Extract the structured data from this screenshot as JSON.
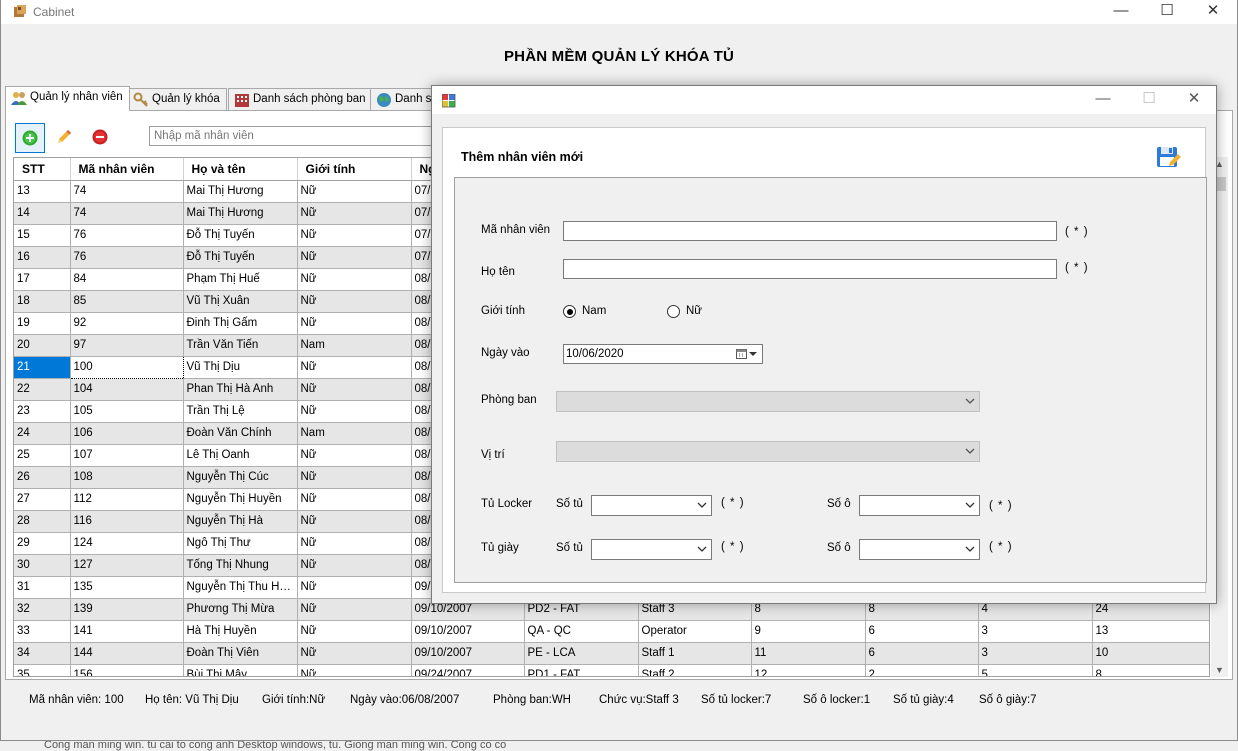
{
  "window": {
    "title": "Cabinet",
    "minimize": "—",
    "maximize": "☐",
    "close": "✕"
  },
  "app_heading": "PHẦN MỀM QUẢN LÝ KHÓA TỦ",
  "tabs": [
    {
      "label": "Quản lý nhân viên",
      "icon": "people-icon"
    },
    {
      "label": "Quản lý khóa",
      "icon": "key-icon"
    },
    {
      "label": "Danh sách phòng ban",
      "icon": "building-icon"
    },
    {
      "label": "Danh s",
      "icon": "globe-icon"
    }
  ],
  "toolbar": {
    "add_icon": "add-icon",
    "edit_icon": "pencil-icon",
    "delete_icon": "delete-icon",
    "search_placeholder": "Nhập mã nhân viên"
  },
  "grid": {
    "columns": [
      "STT",
      "Mã nhân viên",
      "Họ và tên",
      "Giới tính",
      "Ng",
      "",
      "",
      "",
      "",
      "",
      ""
    ],
    "rows": [
      [
        "13",
        "74",
        "Mai Thị Hương",
        "Nữ",
        "07/",
        "",
        "",
        "",
        "",
        "",
        ""
      ],
      [
        "14",
        "74",
        "Mai Thị Hương",
        "Nữ",
        "07/",
        "",
        "",
        "",
        "",
        "",
        ""
      ],
      [
        "15",
        "76",
        "Đỗ Thị Tuyến",
        "Nữ",
        "07/",
        "",
        "",
        "",
        "",
        "",
        ""
      ],
      [
        "16",
        "76",
        "Đỗ Thị Tuyến",
        "Nữ",
        "07/",
        "",
        "",
        "",
        "",
        "",
        ""
      ],
      [
        "17",
        "84",
        "Phạm Thị Huế",
        "Nữ",
        "08/",
        "",
        "",
        "",
        "",
        "",
        ""
      ],
      [
        "18",
        "85",
        "Vũ Thị Xuân",
        "Nữ",
        "08/",
        "",
        "",
        "",
        "",
        "",
        ""
      ],
      [
        "19",
        "92",
        "Đinh Thị Gấm",
        "Nữ",
        "08/",
        "",
        "",
        "",
        "",
        "",
        ""
      ],
      [
        "20",
        "97",
        "Trần Văn Tiến",
        "Nam",
        "08/",
        "",
        "",
        "",
        "",
        "",
        ""
      ],
      [
        "21",
        "100",
        "Vũ Thị Dịu",
        "Nữ",
        "08/",
        "",
        "",
        "",
        "",
        "",
        ""
      ],
      [
        "22",
        "104",
        "Phan Thị Hà Anh",
        "Nữ",
        "08/",
        "",
        "",
        "",
        "",
        "",
        ""
      ],
      [
        "23",
        "105",
        "Trần Thị Lệ",
        "Nữ",
        "08/",
        "",
        "",
        "",
        "",
        "",
        ""
      ],
      [
        "24",
        "106",
        "Đoàn Văn Chính",
        "Nam",
        "08/",
        "",
        "",
        "",
        "",
        "",
        ""
      ],
      [
        "25",
        "107",
        "Lê Thị Oanh",
        "Nữ",
        "08/",
        "",
        "",
        "",
        "",
        "",
        ""
      ],
      [
        "26",
        "108",
        "Nguyễn Thị Cúc",
        "Nữ",
        "08/",
        "",
        "",
        "",
        "",
        "",
        ""
      ],
      [
        "27",
        "112",
        "Nguyễn Thị Huyền",
        "Nữ",
        "08/",
        "",
        "",
        "",
        "",
        "",
        ""
      ],
      [
        "28",
        "116",
        "Nguyễn Thị Hà",
        "Nữ",
        "08/",
        "",
        "",
        "",
        "",
        "",
        ""
      ],
      [
        "29",
        "124",
        "Ngô Thị Thư",
        "Nữ",
        "08/",
        "",
        "",
        "",
        "",
        "",
        ""
      ],
      [
        "30",
        "127",
        "Tống Thị Nhung",
        "Nữ",
        "08/",
        "",
        "",
        "",
        "",
        "",
        ""
      ],
      [
        "31",
        "135",
        "Nguyễn Thị Thu Hư...",
        "Nữ",
        "09/",
        "",
        "",
        "",
        "",
        "",
        ""
      ],
      [
        "32",
        "139",
        "Phương Thị Mừa",
        "Nữ",
        "09/10/2007",
        "PD2 - FAT",
        "Staff 3",
        "8",
        "8",
        "4",
        "24"
      ],
      [
        "33",
        "141",
        "Hà Thị Huyền",
        "Nữ",
        "09/10/2007",
        "QA - QC",
        "Operator",
        "9",
        "6",
        "3",
        "13"
      ],
      [
        "34",
        "144",
        "Đoàn Thị Viên",
        "Nữ",
        "09/10/2007",
        "PE - LCA",
        "Staff 1",
        "11",
        "6",
        "3",
        "10"
      ],
      [
        "35",
        "156",
        "Bùi Thị Mây",
        "Nữ",
        "09/24/2007",
        "PD1 - FAT",
        "Staff 2",
        "12",
        "2",
        "5",
        "8"
      ]
    ]
  },
  "status": {
    "ma": "Mã nhân viên: 100",
    "hoten": "Họ tên: Vũ Thị Dịu",
    "gioitinh": "Giới tính:Nữ",
    "ngayvao": "Ngày vào:06/08/2007",
    "phongban": "Phòng ban:WH",
    "chucvu": "Chức vụ:Staff 3",
    "sotulocker": "Số tủ locker:7",
    "soolocker": "Số ô locker:1",
    "sotugiay": "Số tủ giày:4",
    "soogiay": "Số ô giày:7"
  },
  "bg_text": "Cong man ming win. tu cai to cong anh Desktop windows, tu. Giong man ming win. Cong co co",
  "dialog": {
    "minimize": "—",
    "maximize": "☐",
    "close": "✕",
    "heading": "Thêm nhân viên mới",
    "save_icon": "save-icon",
    "ma_label": "Mã nhân viên",
    "ma_value": "",
    "hoten_label": "Họ tên",
    "hoten_value": "",
    "gioitinh_label": "Giới tính",
    "nam": "Nam",
    "nu": "Nữ",
    "selected_gender": "Nam",
    "ngayvao_label": "Ngày vào",
    "ngayvao_value": "10/06/2020",
    "phongban_label": "Phòng ban",
    "vitri_label": "Vị trí",
    "tulocker_label": "Tủ Locker",
    "tugiay_label": "Tủ giày",
    "sotu_label": "Số tủ",
    "soo_label": "Số ô",
    "required": "( * )"
  }
}
